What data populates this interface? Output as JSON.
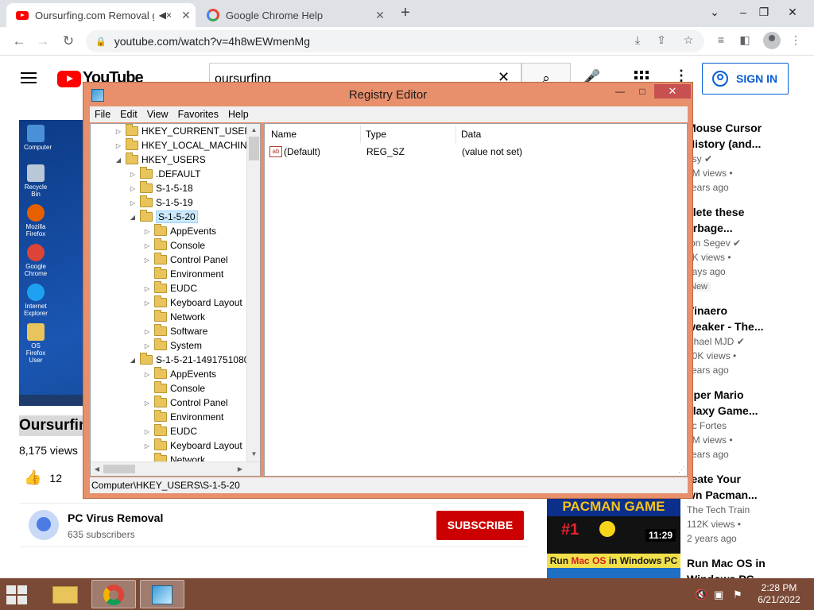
{
  "browser": {
    "tabs": [
      {
        "title": "Oursurfing.com Removal gu",
        "close": "✕"
      },
      {
        "title": "Google Chrome Help",
        "close": "✕"
      }
    ],
    "new_tab": "+",
    "window_controls": {
      "dropdown": "⌄",
      "minimize": "–",
      "restore": "❐",
      "close": "✕"
    },
    "url": "youtube.com/watch?v=4h8wEWmenMg"
  },
  "youtube": {
    "logo_text": "YouTube",
    "search_value": "oursurfing",
    "sign_in": "SIGN IN",
    "video_title": "Oursurfin",
    "views": "8,175 views",
    "likes": "12",
    "channel": {
      "name": "PC Virus Removal",
      "subscribers": "635 subscribers"
    },
    "subscribe": "SUBSCRIBE",
    "desktop_icons": [
      "Computer",
      "Recycle Bin",
      "Mozilla Firefox",
      "Google Chrome",
      "Internet Explorer",
      "OS Firefox User"
    ],
    "recommendations": [
      {
        "t1": "Mouse Cursor",
        "t2": "History (and...",
        "channel": "osy",
        "views": "4M views •",
        "age": "years ago",
        "verified": true
      },
      {
        "t1": "elete these",
        "t2": "arbage...",
        "channel": "ron Segev",
        "views": "4K views •",
        "age": "days ago",
        "badge": "New",
        "verified": true
      },
      {
        "t1": "Vinaero",
        "t2": "weaker - The...",
        "channel": "ichael MJD",
        "views": "60K views •",
        "age": "years ago",
        "verified": true
      },
      {
        "t1": "uper Mario",
        "t2": "alaxy Game...",
        "channel": "ric Fortes",
        "views": "1M views •",
        "age": "years ago"
      },
      {
        "t1": "reate Your",
        "t2": "wn Pacman...",
        "channel": "The Tech Train",
        "views": "112K views •",
        "age": "2 years ago"
      },
      {
        "t1": "Run Mac OS in",
        "t2": "Windows PC"
      }
    ],
    "pacman_thumb": {
      "title": "PACMAN GAME",
      "rank": "#1",
      "duration": "11:29"
    },
    "macos_thumb": {
      "title_a": "Run ",
      "title_b": "Mac OS",
      "title_c": " in Windows PC"
    }
  },
  "regedit": {
    "title": "Registry Editor",
    "close": "✕",
    "minimize": "—",
    "maximize": "□",
    "menu": [
      "File",
      "Edit",
      "View",
      "Favorites",
      "Help"
    ],
    "tree": [
      {
        "label": "HKEY_CURRENT_USER",
        "expander": "▷",
        "level": 0
      },
      {
        "label": "HKEY_LOCAL_MACHINE",
        "expander": "▷",
        "level": 0
      },
      {
        "label": "HKEY_USERS",
        "expander": "◢",
        "level": 0
      },
      {
        "label": ".DEFAULT",
        "expander": "▷",
        "level": 1
      },
      {
        "label": "S-1-5-18",
        "expander": "▷",
        "level": 1
      },
      {
        "label": "S-1-5-19",
        "expander": "▷",
        "level": 1
      },
      {
        "label": "S-1-5-20",
        "expander": "◢",
        "level": 1,
        "selected": true
      },
      {
        "label": "AppEvents",
        "expander": "▷",
        "level": 2
      },
      {
        "label": "Console",
        "expander": "▷",
        "level": 2
      },
      {
        "label": "Control Panel",
        "expander": "▷",
        "level": 2
      },
      {
        "label": "Environment",
        "expander": "",
        "level": 2
      },
      {
        "label": "EUDC",
        "expander": "▷",
        "level": 2
      },
      {
        "label": "Keyboard Layout",
        "expander": "▷",
        "level": 2
      },
      {
        "label": "Network",
        "expander": "",
        "level": 2
      },
      {
        "label": "Software",
        "expander": "▷",
        "level": 2
      },
      {
        "label": "System",
        "expander": "▷",
        "level": 2
      },
      {
        "label": "S-1-5-21-1491751080-",
        "expander": "◢",
        "level": 1
      },
      {
        "label": "AppEvents",
        "expander": "▷",
        "level": 2
      },
      {
        "label": "Console",
        "expander": "",
        "level": 2
      },
      {
        "label": "Control Panel",
        "expander": "▷",
        "level": 2
      },
      {
        "label": "Environment",
        "expander": "",
        "level": 2
      },
      {
        "label": "EUDC",
        "expander": "▷",
        "level": 2
      },
      {
        "label": "Keyboard Layout",
        "expander": "▷",
        "level": 2
      },
      {
        "label": "Network",
        "expander": "",
        "level": 2
      }
    ],
    "columns": [
      "Name",
      "Type",
      "Data"
    ],
    "values": [
      {
        "name": "(Default)",
        "type": "REG_SZ",
        "data": "(value not set)"
      }
    ],
    "status": "Computer\\HKEY_USERS\\S-1-5-20"
  },
  "taskbar": {
    "time": "2:28 PM",
    "date": "6/21/2022"
  }
}
